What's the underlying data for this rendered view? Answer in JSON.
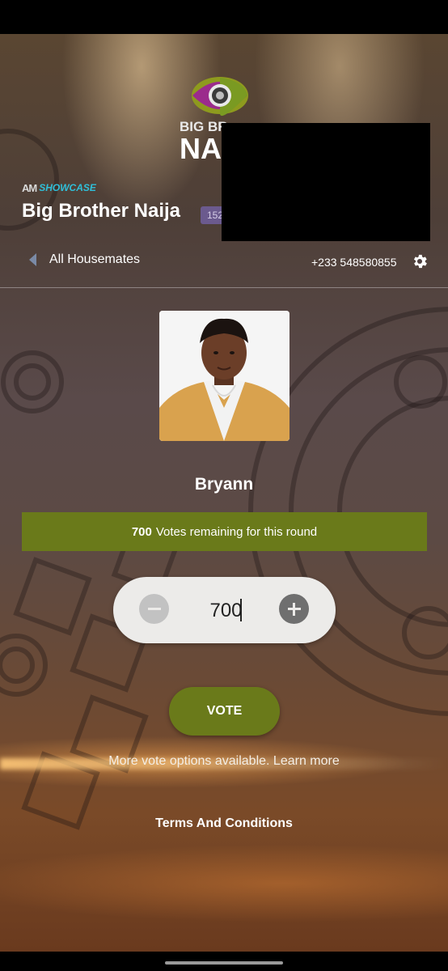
{
  "header": {
    "logo_line1": "BIG BR",
    "logo_line2": "NA",
    "brand_mark": "AM",
    "brand_sub": "SHOWCASE",
    "title": "Big Brother Naija",
    "badge": "152"
  },
  "nav": {
    "back_label": "All Housemates",
    "phone": "+233 548580855"
  },
  "housemate": {
    "name": "Bryann"
  },
  "votes": {
    "count": "700",
    "text": "Votes remaining for this round"
  },
  "stepper": {
    "value": "700"
  },
  "actions": {
    "vote_label": "VOTE",
    "more_prefix": "More vote options available.",
    "learn_more": "Learn more",
    "terms": "Terms And Conditions"
  },
  "colors": {
    "accent": "#6a7a1a",
    "badge": "#6b5a8e",
    "brand_sub": "#2fbfd9"
  }
}
